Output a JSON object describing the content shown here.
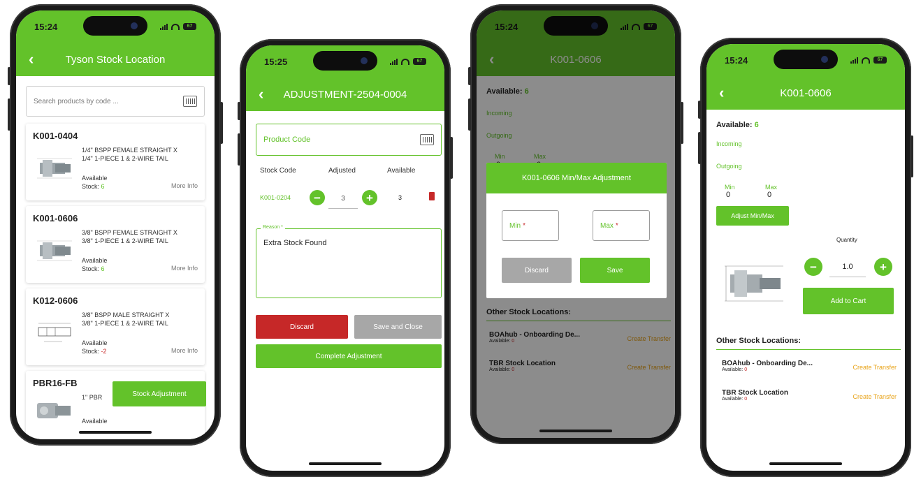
{
  "status_bar": {
    "p1_time": "15:24",
    "p2_time": "15:25",
    "p3_time": "15:24",
    "p4_time": "15:24",
    "battery": "67"
  },
  "colors": {
    "accent": "#63c22a",
    "danger": "#c62828",
    "warning": "#e8a318",
    "neutral": "#a7a7a7"
  },
  "phone1": {
    "title": "Tyson Stock Location",
    "search_placeholder": "Search products by code ...",
    "products": [
      {
        "code": "K001-0404",
        "desc_line1": "1/4\" BSPP FEMALE STRAIGHT X",
        "desc_line2": "1/4\" 1-PIECE 1 & 2-WIRE TAIL",
        "available_label": "Available",
        "stock_label": "Stock:",
        "stock_value": "6",
        "more_info": "More Info"
      },
      {
        "code": "K001-0606",
        "desc_line1": "3/8\" BSPP FEMALE STRAIGHT X",
        "desc_line2": "3/8\" 1-PIECE 1 & 2-WIRE TAIL",
        "available_label": "Available",
        "stock_label": "Stock:",
        "stock_value": "6",
        "more_info": "More Info"
      },
      {
        "code": "K012-0606",
        "desc_line1": "3/8\" BSPP MALE STRAIGHT X",
        "desc_line2": "3/8\" 1-PIECE 1 & 2-WIRE TAIL",
        "available_label": "Available",
        "stock_label": "Stock:",
        "stock_value": "-2",
        "more_info": "More Info"
      },
      {
        "code": "PBR16-FB",
        "desc_line1": "1\" PBR",
        "desc_line2": "",
        "available_label": "Available",
        "stock_label": "",
        "stock_value": "",
        "more_info": ""
      }
    ],
    "fab_label": "Stock Adjustment"
  },
  "phone2": {
    "title": "ADJUSTMENT-2504-0004",
    "product_code_placeholder": "Product Code",
    "headers": {
      "stock_code": "Stock Code",
      "adjusted": "Adjusted",
      "available": "Available"
    },
    "row": {
      "stock_code": "K001-0204",
      "adjusted": "3",
      "available": "3"
    },
    "reason_label": "Reason *",
    "reason_value": "Extra Stock Found",
    "discard_label": "Discard",
    "save_close_label": "Save and Close",
    "complete_label": "Complete Adjustment"
  },
  "phone3": {
    "title": "K001-0606",
    "available_label": "Available:",
    "available_value": "6",
    "incoming_label": "Incoming",
    "outgoing_label": "Outgoing",
    "min_label": "Min",
    "max_label": "Max",
    "min_value": "0",
    "max_value": "0",
    "modal_title": "K001-0606 Min/Max Adjustment",
    "min_placeholder": "Min",
    "max_placeholder": "Max",
    "required_mark": "*",
    "discard_label": "Discard",
    "save_label": "Save",
    "other_locations_title": "Other Stock Locations:",
    "locations": [
      {
        "name": "BOAhub - Onboarding De...",
        "available_label": "Available:",
        "available_value": "0",
        "action": "Create Transfer"
      },
      {
        "name": "TBR Stock Location",
        "available_label": "Available:",
        "available_value": "0",
        "action": "Create Transfer"
      }
    ]
  },
  "phone4": {
    "title": "K001-0606",
    "available_label": "Available:",
    "available_value": "6",
    "incoming_label": "Incoming",
    "outgoing_label": "Outgoing",
    "min_label": "Min",
    "max_label": "Max",
    "min_value": "0",
    "max_value": "0",
    "adjust_label": "Adjust Min/Max",
    "quantity_label": "Quantity",
    "quantity_value": "1.0",
    "add_to_cart_label": "Add to Cart",
    "other_locations_title": "Other Stock Locations:",
    "locations": [
      {
        "name": "BOAhub - Onboarding De...",
        "available_label": "Available:",
        "available_value": "0",
        "action": "Create Transfer"
      },
      {
        "name": "TBR Stock Location",
        "available_label": "Available:",
        "available_value": "0",
        "action": "Create Transfer"
      }
    ]
  }
}
